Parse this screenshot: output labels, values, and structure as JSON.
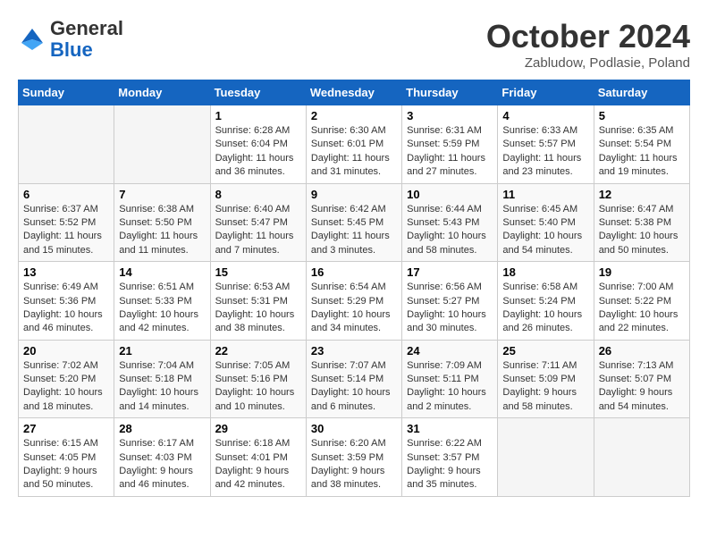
{
  "header": {
    "logo": {
      "general": "General",
      "blue": "Blue"
    },
    "title": "October 2024",
    "location": "Zabludow, Podlasie, Poland"
  },
  "weekdays": [
    "Sunday",
    "Monday",
    "Tuesday",
    "Wednesday",
    "Thursday",
    "Friday",
    "Saturday"
  ],
  "weeks": [
    [
      {
        "day": "",
        "sunrise": "",
        "sunset": "",
        "daylight": "",
        "empty": true
      },
      {
        "day": "",
        "sunrise": "",
        "sunset": "",
        "daylight": "",
        "empty": true
      },
      {
        "day": "1",
        "sunrise": "Sunrise: 6:28 AM",
        "sunset": "Sunset: 6:04 PM",
        "daylight": "Daylight: 11 hours and 36 minutes."
      },
      {
        "day": "2",
        "sunrise": "Sunrise: 6:30 AM",
        "sunset": "Sunset: 6:01 PM",
        "daylight": "Daylight: 11 hours and 31 minutes."
      },
      {
        "day": "3",
        "sunrise": "Sunrise: 6:31 AM",
        "sunset": "Sunset: 5:59 PM",
        "daylight": "Daylight: 11 hours and 27 minutes."
      },
      {
        "day": "4",
        "sunrise": "Sunrise: 6:33 AM",
        "sunset": "Sunset: 5:57 PM",
        "daylight": "Daylight: 11 hours and 23 minutes."
      },
      {
        "day": "5",
        "sunrise": "Sunrise: 6:35 AM",
        "sunset": "Sunset: 5:54 PM",
        "daylight": "Daylight: 11 hours and 19 minutes."
      }
    ],
    [
      {
        "day": "6",
        "sunrise": "Sunrise: 6:37 AM",
        "sunset": "Sunset: 5:52 PM",
        "daylight": "Daylight: 11 hours and 15 minutes."
      },
      {
        "day": "7",
        "sunrise": "Sunrise: 6:38 AM",
        "sunset": "Sunset: 5:50 PM",
        "daylight": "Daylight: 11 hours and 11 minutes."
      },
      {
        "day": "8",
        "sunrise": "Sunrise: 6:40 AM",
        "sunset": "Sunset: 5:47 PM",
        "daylight": "Daylight: 11 hours and 7 minutes."
      },
      {
        "day": "9",
        "sunrise": "Sunrise: 6:42 AM",
        "sunset": "Sunset: 5:45 PM",
        "daylight": "Daylight: 11 hours and 3 minutes."
      },
      {
        "day": "10",
        "sunrise": "Sunrise: 6:44 AM",
        "sunset": "Sunset: 5:43 PM",
        "daylight": "Daylight: 10 hours and 58 minutes."
      },
      {
        "day": "11",
        "sunrise": "Sunrise: 6:45 AM",
        "sunset": "Sunset: 5:40 PM",
        "daylight": "Daylight: 10 hours and 54 minutes."
      },
      {
        "day": "12",
        "sunrise": "Sunrise: 6:47 AM",
        "sunset": "Sunset: 5:38 PM",
        "daylight": "Daylight: 10 hours and 50 minutes."
      }
    ],
    [
      {
        "day": "13",
        "sunrise": "Sunrise: 6:49 AM",
        "sunset": "Sunset: 5:36 PM",
        "daylight": "Daylight: 10 hours and 46 minutes."
      },
      {
        "day": "14",
        "sunrise": "Sunrise: 6:51 AM",
        "sunset": "Sunset: 5:33 PM",
        "daylight": "Daylight: 10 hours and 42 minutes."
      },
      {
        "day": "15",
        "sunrise": "Sunrise: 6:53 AM",
        "sunset": "Sunset: 5:31 PM",
        "daylight": "Daylight: 10 hours and 38 minutes."
      },
      {
        "day": "16",
        "sunrise": "Sunrise: 6:54 AM",
        "sunset": "Sunset: 5:29 PM",
        "daylight": "Daylight: 10 hours and 34 minutes."
      },
      {
        "day": "17",
        "sunrise": "Sunrise: 6:56 AM",
        "sunset": "Sunset: 5:27 PM",
        "daylight": "Daylight: 10 hours and 30 minutes."
      },
      {
        "day": "18",
        "sunrise": "Sunrise: 6:58 AM",
        "sunset": "Sunset: 5:24 PM",
        "daylight": "Daylight: 10 hours and 26 minutes."
      },
      {
        "day": "19",
        "sunrise": "Sunrise: 7:00 AM",
        "sunset": "Sunset: 5:22 PM",
        "daylight": "Daylight: 10 hours and 22 minutes."
      }
    ],
    [
      {
        "day": "20",
        "sunrise": "Sunrise: 7:02 AM",
        "sunset": "Sunset: 5:20 PM",
        "daylight": "Daylight: 10 hours and 18 minutes."
      },
      {
        "day": "21",
        "sunrise": "Sunrise: 7:04 AM",
        "sunset": "Sunset: 5:18 PM",
        "daylight": "Daylight: 10 hours and 14 minutes."
      },
      {
        "day": "22",
        "sunrise": "Sunrise: 7:05 AM",
        "sunset": "Sunset: 5:16 PM",
        "daylight": "Daylight: 10 hours and 10 minutes."
      },
      {
        "day": "23",
        "sunrise": "Sunrise: 7:07 AM",
        "sunset": "Sunset: 5:14 PM",
        "daylight": "Daylight: 10 hours and 6 minutes."
      },
      {
        "day": "24",
        "sunrise": "Sunrise: 7:09 AM",
        "sunset": "Sunset: 5:11 PM",
        "daylight": "Daylight: 10 hours and 2 minutes."
      },
      {
        "day": "25",
        "sunrise": "Sunrise: 7:11 AM",
        "sunset": "Sunset: 5:09 PM",
        "daylight": "Daylight: 9 hours and 58 minutes."
      },
      {
        "day": "26",
        "sunrise": "Sunrise: 7:13 AM",
        "sunset": "Sunset: 5:07 PM",
        "daylight": "Daylight: 9 hours and 54 minutes."
      }
    ],
    [
      {
        "day": "27",
        "sunrise": "Sunrise: 6:15 AM",
        "sunset": "Sunset: 4:05 PM",
        "daylight": "Daylight: 9 hours and 50 minutes."
      },
      {
        "day": "28",
        "sunrise": "Sunrise: 6:17 AM",
        "sunset": "Sunset: 4:03 PM",
        "daylight": "Daylight: 9 hours and 46 minutes."
      },
      {
        "day": "29",
        "sunrise": "Sunrise: 6:18 AM",
        "sunset": "Sunset: 4:01 PM",
        "daylight": "Daylight: 9 hours and 42 minutes."
      },
      {
        "day": "30",
        "sunrise": "Sunrise: 6:20 AM",
        "sunset": "Sunset: 3:59 PM",
        "daylight": "Daylight: 9 hours and 38 minutes."
      },
      {
        "day": "31",
        "sunrise": "Sunrise: 6:22 AM",
        "sunset": "Sunset: 3:57 PM",
        "daylight": "Daylight: 9 hours and 35 minutes."
      },
      {
        "day": "",
        "sunrise": "",
        "sunset": "",
        "daylight": "",
        "empty": true
      },
      {
        "day": "",
        "sunrise": "",
        "sunset": "",
        "daylight": "",
        "empty": true
      }
    ]
  ]
}
